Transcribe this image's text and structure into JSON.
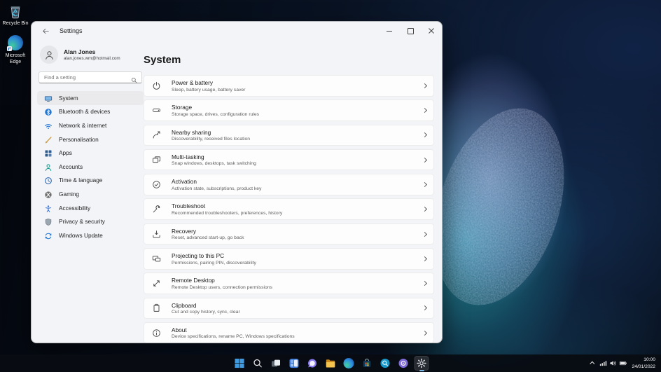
{
  "colors": {
    "accent": "#0067c0",
    "taskbar_bg": "#0a0d12",
    "card_bg": "#fdfdfd",
    "window_bg": "#f2f4f8",
    "active_underline": "#7ab8e8"
  },
  "desktop": {
    "icons": [
      {
        "label": "Recycle Bin",
        "icon": "recycle-bin-icon"
      },
      {
        "label": "Microsoft Edge",
        "icon": "edge-icon"
      }
    ]
  },
  "window": {
    "titlebar": {
      "title": "Settings",
      "controls": [
        "minimize",
        "maximize",
        "close"
      ]
    },
    "sidebar": {
      "user": {
        "name": "Alan Jones",
        "email": "alan.jones.wm@hotmail.com"
      },
      "search": {
        "placeholder": "Find a setting",
        "icon": "search-icon"
      },
      "items": [
        {
          "label": "System",
          "icon": "system-icon",
          "selected": true
        },
        {
          "label": "Bluetooth & devices",
          "icon": "bluetooth-icon",
          "selected": false
        },
        {
          "label": "Network & internet",
          "icon": "network-icon",
          "selected": false
        },
        {
          "label": "Personalisation",
          "icon": "personalisation-icon",
          "selected": false
        },
        {
          "label": "Apps",
          "icon": "apps-icon",
          "selected": false
        },
        {
          "label": "Accounts",
          "icon": "accounts-icon",
          "selected": false
        },
        {
          "label": "Time & language",
          "icon": "time-language-icon",
          "selected": false
        },
        {
          "label": "Gaming",
          "icon": "gaming-icon",
          "selected": false
        },
        {
          "label": "Accessibility",
          "icon": "accessibility-icon",
          "selected": false
        },
        {
          "label": "Privacy & security",
          "icon": "privacy-security-icon",
          "selected": false
        },
        {
          "label": "Windows Update",
          "icon": "windows-update-icon",
          "selected": false
        }
      ]
    },
    "main": {
      "title": "System",
      "cards": [
        {
          "title": "Power & battery",
          "subtitle": "Sleep, battery usage, battery saver",
          "icon": "power-icon"
        },
        {
          "title": "Storage",
          "subtitle": "Storage space, drives, configuration rules",
          "icon": "storage-icon"
        },
        {
          "title": "Nearby sharing",
          "subtitle": "Discoverability, received files location",
          "icon": "nearby-sharing-icon"
        },
        {
          "title": "Multi-tasking",
          "subtitle": "Snap windows, desktops, task switching",
          "icon": "multitasking-icon"
        },
        {
          "title": "Activation",
          "subtitle": "Activation state, subscriptions, product key",
          "icon": "activation-icon"
        },
        {
          "title": "Troubleshoot",
          "subtitle": "Recommended troubleshooters, preferences, history",
          "icon": "troubleshoot-icon"
        },
        {
          "title": "Recovery",
          "subtitle": "Reset, advanced start-up, go back",
          "icon": "recovery-icon"
        },
        {
          "title": "Projecting to this PC",
          "subtitle": "Permissions, pairing PIN, discoverability",
          "icon": "projecting-icon"
        },
        {
          "title": "Remote Desktop",
          "subtitle": "Remote Desktop users, connection permissions",
          "icon": "remote-desktop-icon"
        },
        {
          "title": "Clipboard",
          "subtitle": "Cut and copy history, sync, clear",
          "icon": "clipboard-icon"
        },
        {
          "title": "About",
          "subtitle": "Device specifications, rename PC, Windows specifications",
          "icon": "about-icon"
        }
      ]
    }
  },
  "taskbar": {
    "icons": [
      "start",
      "search",
      "task-view",
      "widgets",
      "chat",
      "file-explorer",
      "edge",
      "microsoft-store",
      "search-app",
      "media-app",
      "settings"
    ],
    "active_icon": "settings",
    "tray": {
      "icons": [
        "chevron-up",
        "network",
        "volume",
        "battery"
      ],
      "time": "10:00",
      "date": "24/01/2022"
    }
  }
}
